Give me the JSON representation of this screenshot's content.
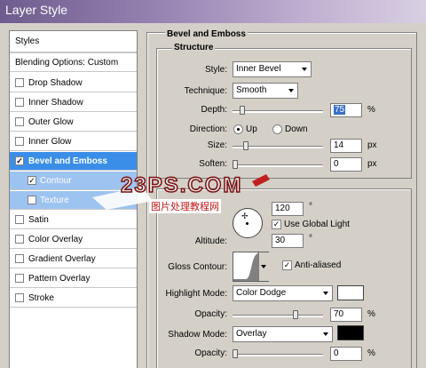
{
  "window": {
    "title": "Layer Style"
  },
  "left_panel": {
    "header": "Styles",
    "blending": "Blending Options: Custom",
    "items": [
      {
        "label": "Drop Shadow",
        "checked": false
      },
      {
        "label": "Inner Shadow",
        "checked": false
      },
      {
        "label": "Outer Glow",
        "checked": false
      },
      {
        "label": "Inner Glow",
        "checked": false
      },
      {
        "label": "Bevel and Emboss",
        "checked": true
      },
      {
        "label": "Contour",
        "checked": true
      },
      {
        "label": "Texture",
        "checked": false
      },
      {
        "label": "Satin",
        "checked": false
      },
      {
        "label": "Color Overlay",
        "checked": false
      },
      {
        "label": "Gradient Overlay",
        "checked": false
      },
      {
        "label": "Pattern Overlay",
        "checked": false
      },
      {
        "label": "Stroke",
        "checked": false
      }
    ]
  },
  "bevel": {
    "section_title": "Bevel and Emboss",
    "structure_title": "Structure",
    "style_label": "Style:",
    "style_value": "Inner Bevel",
    "technique_label": "Technique:",
    "technique_value": "Smooth",
    "depth_label": "Depth:",
    "depth_value": "75",
    "depth_unit": "%",
    "direction_label": "Direction:",
    "direction_up": "Up",
    "direction_down": "Down",
    "size_label": "Size:",
    "size_value": "14",
    "size_unit": "px",
    "soften_label": "Soften:",
    "soften_value": "0",
    "soften_unit": "px"
  },
  "shading": {
    "angle_value": "120",
    "degree": "°",
    "use_global_light": "Use Global Light",
    "altitude_label": "Altitude:",
    "altitude_value": "30",
    "gloss_contour_label": "Gloss Contour:",
    "anti_aliased": "Anti-aliased",
    "highlight_mode_label": "Highlight Mode:",
    "highlight_mode_value": "Color Dodge",
    "highlight_opacity_label": "Opacity:",
    "highlight_opacity_value": "70",
    "shadow_mode_label": "Shadow Mode:",
    "shadow_mode_value": "Overlay",
    "shadow_opacity_label": "Opacity:",
    "shadow_opacity_value": "0",
    "percent": "%"
  },
  "colors": {
    "highlight_color": "#ffffff",
    "shadow_color": "#000000",
    "selected_row": "#3b8ee8"
  },
  "watermark": {
    "logo": "23PS.COM",
    "subtitle": "图片处理教程网"
  }
}
